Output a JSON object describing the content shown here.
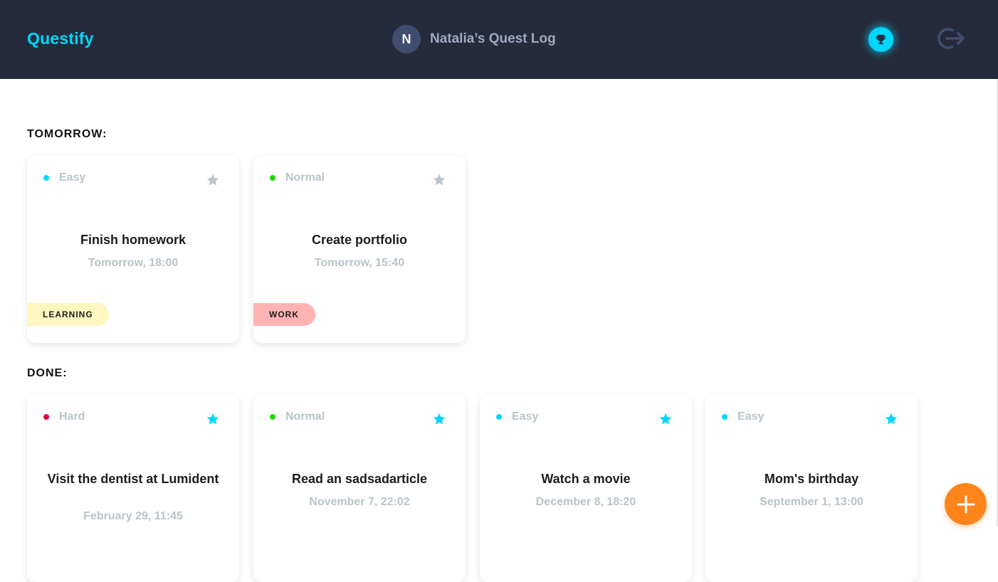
{
  "app": {
    "logo": "Questify"
  },
  "user": {
    "initial": "N",
    "title": "Natalia’s Quest Log"
  },
  "colors": {
    "header_bg": "#252b3b",
    "accent": "#00d7ff",
    "fab": "#ff851b",
    "easy": "#00d7ff",
    "normal": "#24d40c",
    "hard": "#db0837",
    "star_inactive": "#b9c3c8",
    "star_active": "#00d7ff"
  },
  "icons": {
    "trophy": "trophy-icon",
    "logout": "logout-icon",
    "star": "star-icon",
    "add": "plus-icon"
  },
  "sections": {
    "tomorrow": {
      "title": "TOMORROW:",
      "cards": [
        {
          "difficulty": "Easy",
          "title": "Finish homework",
          "date": "Tomorrow, 18:00",
          "category": "LEARNING",
          "starred": false
        },
        {
          "difficulty": "Normal",
          "title": "Create portfolio",
          "date": "Tomorrow, 15:40",
          "category": "WORK",
          "starred": false
        }
      ]
    },
    "done": {
      "title": "DONE:",
      "cards": [
        {
          "difficulty": "Hard",
          "title": "Visit the dentist at Lumident",
          "date": "February 29, 11:45",
          "starred": true
        },
        {
          "difficulty": "Normal",
          "title": "Read an sadsadarticle",
          "date": "November 7, 22:02",
          "starred": true
        },
        {
          "difficulty": "Easy",
          "title": "Watch a movie",
          "date": "December 8, 18:20",
          "starred": true
        },
        {
          "difficulty": "Easy",
          "title": "Mom's birthday",
          "date": "September 1, 13:00",
          "starred": true
        }
      ]
    }
  }
}
